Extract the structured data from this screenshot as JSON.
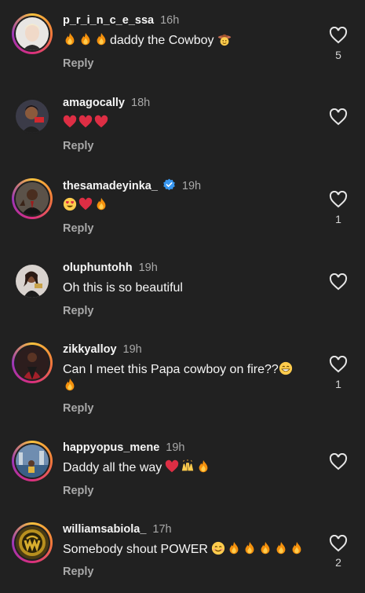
{
  "comments": [
    {
      "username": "p_r_i_n_c_e_ssa",
      "time": "16h",
      "text": "daddy the Cowboy",
      "reply": "Reply",
      "likes": "5",
      "emojis_before": [
        "fire",
        "fire",
        "fire"
      ],
      "emojis_after": [
        "cowboy-face"
      ]
    },
    {
      "username": "amagocally",
      "time": "18h",
      "text": "",
      "reply": "Reply",
      "likes": "",
      "emojis_before": [
        "red-heart",
        "red-heart",
        "red-heart"
      ],
      "emojis_after": []
    },
    {
      "username": "thesamadeyinka_",
      "time": "19h",
      "verified": true,
      "text": "",
      "reply": "Reply",
      "likes": "1",
      "emojis_before": [
        "heart-eyes",
        "red-heart",
        "fire"
      ],
      "emojis_after": []
    },
    {
      "username": "oluphuntohh",
      "time": "19h",
      "text": "Oh this is so beautiful",
      "reply": "Reply",
      "likes": "",
      "emojis_before": [],
      "emojis_after": []
    },
    {
      "username": "zikkyalloy",
      "time": "19h",
      "text": "Can I meet this Papa cowboy on fire??",
      "reply": "Reply",
      "likes": "1",
      "emojis_before": [],
      "emojis_after": [
        "grinning",
        "fire"
      ]
    },
    {
      "username": "happyopus_mene",
      "time": "19h",
      "text": "Daddy all the way",
      "reply": "Reply",
      "likes": "",
      "emojis_before": [],
      "emojis_after": [
        "red-heart",
        "raising-hands",
        "fire"
      ]
    },
    {
      "username": "williamsabiola_",
      "time": "17h",
      "text": "Somebody shout POWER",
      "reply": "Reply",
      "likes": "2",
      "emojis_before": [],
      "emojis_after": [
        "smiling",
        "fire",
        "fire",
        "fire",
        "fire",
        "fire"
      ]
    }
  ],
  "colors": {
    "background": "#212121",
    "secondary_text": "#a8a8a8",
    "verified_blue": "#3897f0",
    "story_ring": [
      "#f9c23c",
      "#d92e7f",
      "#9b36b7"
    ]
  }
}
